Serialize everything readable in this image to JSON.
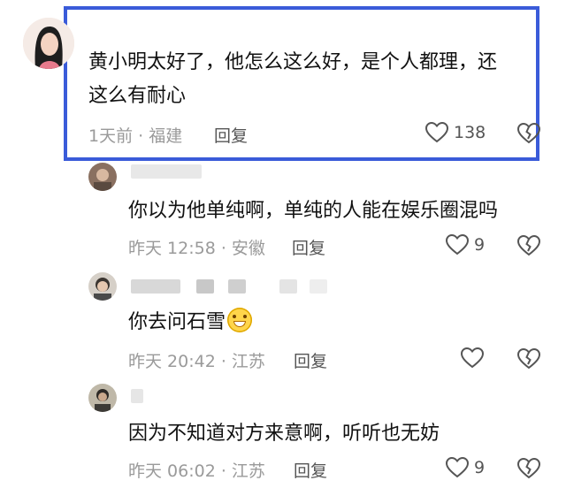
{
  "comments": [
    {
      "text_line1": "黄小明太好了，他怎么这么好，是个人都理，还",
      "text_line2": "这么有耐心",
      "meta": "1天前 · 福建",
      "reply_label": "回复",
      "likes": "138"
    },
    {
      "text": "你以为他单纯啊，单纯的人能在娱乐圈混吗",
      "meta": "昨天 12:58 · 安徽",
      "reply_label": "回复",
      "likes": "9"
    },
    {
      "text": "你去问石雪",
      "meta": "昨天 20:42 · 江苏",
      "reply_label": "回复",
      "likes": ""
    },
    {
      "text": "因为不知道对方来意啊，听听也无妨",
      "meta": "昨天 06:02 · 江苏",
      "reply_label": "回复",
      "likes": "9"
    }
  ],
  "icons": {
    "like": "heart-outline-icon",
    "dislike": "broken-heart-icon",
    "emoji": "grinning-sweat-emoji"
  },
  "colors": {
    "highlight_border": "#3a5bd9",
    "meta_text": "#9a9a9a"
  }
}
